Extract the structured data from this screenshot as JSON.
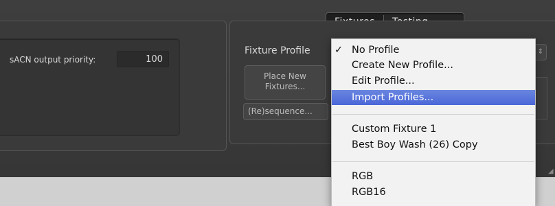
{
  "tabs": [
    {
      "label": "Fixtures",
      "active": true
    },
    {
      "label": "Testing",
      "active": false
    }
  ],
  "sacn": {
    "label": "sACN output priority:",
    "value": "100"
  },
  "fixture_profile": {
    "label": "Fixture Profile"
  },
  "buttons": {
    "place_new_line1": "Place New",
    "place_new_line2": "Fixtures...",
    "resequence": "(Re)sequence..."
  },
  "menu": {
    "checkmark": "✓",
    "items": [
      {
        "label": "No Profile",
        "checked": true
      },
      {
        "label": "Create New Profile..."
      },
      {
        "label": "Edit Profile..."
      },
      {
        "label": "Import Profiles...",
        "highlighted": true
      },
      {
        "label": "Custom Fixture 1"
      },
      {
        "label": "Best Boy Wash (26) Copy"
      },
      {
        "label": "RGB"
      },
      {
        "label": "RGB16"
      }
    ]
  },
  "colors": {
    "menu_highlight": "#4a67d8",
    "panel_bg": "#3a3a3a"
  }
}
